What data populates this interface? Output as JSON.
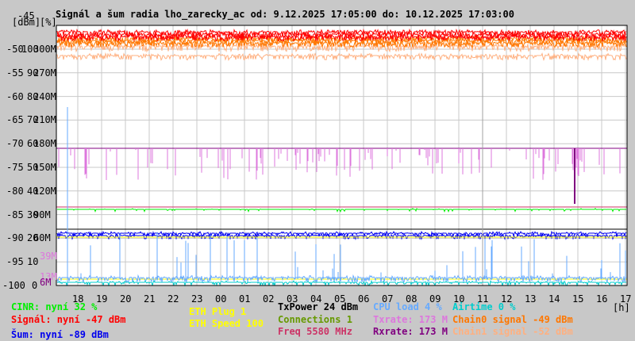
{
  "title": "Signál a šum radia lho_zarecky_ac od: 9.12.2025 17:05:00 do: 10.12.2025 17:03:00",
  "axis": {
    "units": [
      "[dBm]",
      "[%]"
    ],
    "top_label": "-45",
    "dbm_ticks": [
      "-50",
      "-55",
      "-60",
      "-65",
      "-70",
      "-75",
      "-80",
      "-85",
      "-90",
      "-95",
      "-100"
    ],
    "pct_ticks": [
      "100",
      "90",
      "80",
      "70",
      "60",
      "50",
      "40",
      "30",
      "20",
      "10",
      "0"
    ],
    "rate_ticks": [
      "300M",
      "270M",
      "240M",
      "210M",
      "180M",
      "150M",
      "120M",
      "90M",
      "60M"
    ],
    "extra_ticks": [
      "39M",
      "13M",
      "6M"
    ],
    "hours": [
      "18",
      "19",
      "20",
      "21",
      "22",
      "23",
      "00",
      "01",
      "02",
      "03",
      "04",
      "05",
      "06",
      "07",
      "08",
      "09",
      "10",
      "11",
      "12",
      "13",
      "14",
      "15",
      "16",
      "17"
    ],
    "hour_unit": "[h]"
  },
  "legend": {
    "cinr": "CINR: nyní 32 %",
    "signal": "Signál: nyní -47 dBm",
    "noise": "Šum: nyní -89 dBm",
    "eth_plug": "ETH Plug 1",
    "eth_speed": "ETH Speed 100",
    "txpower": "TxPower 24 dBm",
    "connections": "Connections 1",
    "freq": "Freq 5580 MHz",
    "cpu": "CPU load 4 %",
    "txrate": "Txrate: 173 M",
    "rxrate": "Rxrate: 173 M",
    "airtime": "Airtime 0 %",
    "chain0": "Chain0 signal -49 dBm",
    "chain1": "Chain1 signal -52 dBm"
  },
  "colors": {
    "cinr": "#00ee00",
    "signal": "#ff0000",
    "noise": "#0000ee",
    "eth": "#ffff00",
    "txpower": "#000000",
    "connections": "#669900",
    "freq": "#cc3366",
    "cpu": "#66aaff",
    "txrate": "#dd77dd",
    "rxrate": "#800080",
    "airtime": "#00cccc",
    "chain0": "#ff7700",
    "chain1": "#ffb080"
  }
}
